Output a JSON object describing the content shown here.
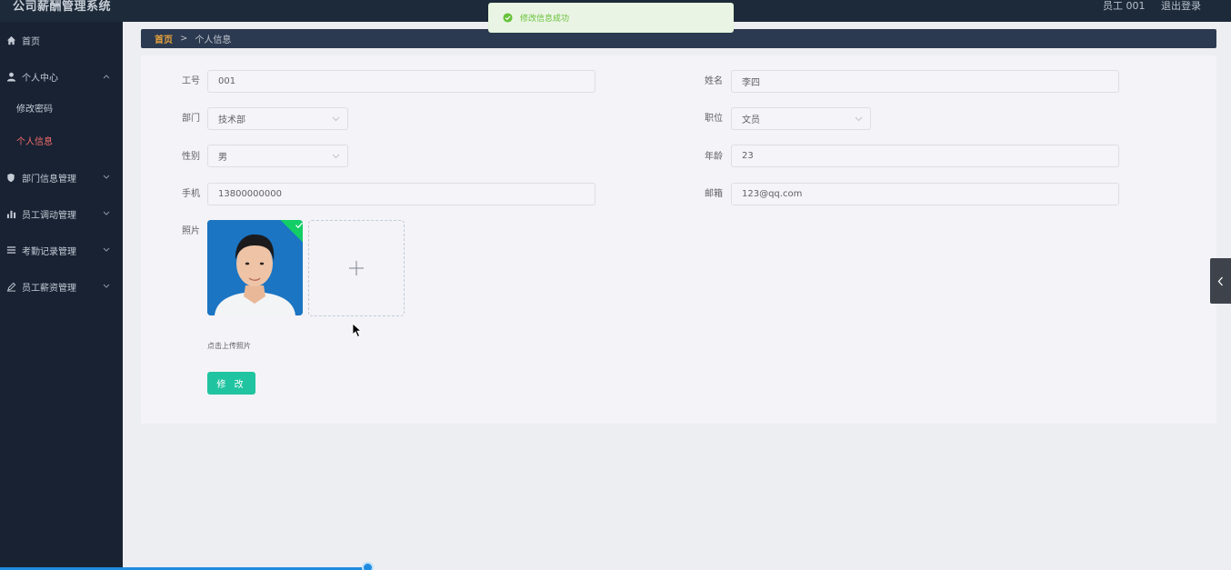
{
  "header": {
    "app_title": "公司薪酬管理系统",
    "user_label": "员工 001",
    "logout_label": "退出登录"
  },
  "sidebar": {
    "items": [
      {
        "label": "首页",
        "icon": "home-icon"
      },
      {
        "label": "个人中心",
        "icon": "user-icon",
        "expanded": true,
        "children": [
          {
            "label": "修改密码",
            "active": false
          },
          {
            "label": "个人信息",
            "active": true
          }
        ]
      },
      {
        "label": "部门信息管理",
        "icon": "shield-icon"
      },
      {
        "label": "员工调动管理",
        "icon": "bar-chart-icon"
      },
      {
        "label": "考勤记录管理",
        "icon": "list-icon"
      },
      {
        "label": "员工薪资管理",
        "icon": "edit-icon"
      }
    ]
  },
  "breadcrumb": {
    "home": "首页",
    "separator": ">",
    "current": "个人信息"
  },
  "form": {
    "employee_no": {
      "label": "工号",
      "value": "001"
    },
    "name": {
      "label": "姓名",
      "value": "李四"
    },
    "department": {
      "label": "部门",
      "value": "技术部"
    },
    "position": {
      "label": "职位",
      "value": "文员"
    },
    "gender": {
      "label": "性别",
      "value": "男"
    },
    "age": {
      "label": "年龄",
      "value": "23"
    },
    "phone": {
      "label": "手机",
      "value": "13800000000"
    },
    "email": {
      "label": "邮箱",
      "value": "123@qq.com"
    },
    "photo": {
      "label": "照片",
      "upload_tip": "点击上传照片",
      "upload_icon": "plus-icon"
    },
    "submit_label": "修 改"
  },
  "toast": {
    "message": "修改信息成功",
    "icon": "success-check-icon"
  },
  "colors": {
    "sidebar_bg": "#182233",
    "topbar_bg": "#1d2a3a",
    "breadcrumb_bg": "#2b3a50",
    "breadcrumb_home": "#e6a23c",
    "active_nav": "#f56c6c",
    "primary_button": "#20c4a0",
    "success": "#67c23a"
  }
}
